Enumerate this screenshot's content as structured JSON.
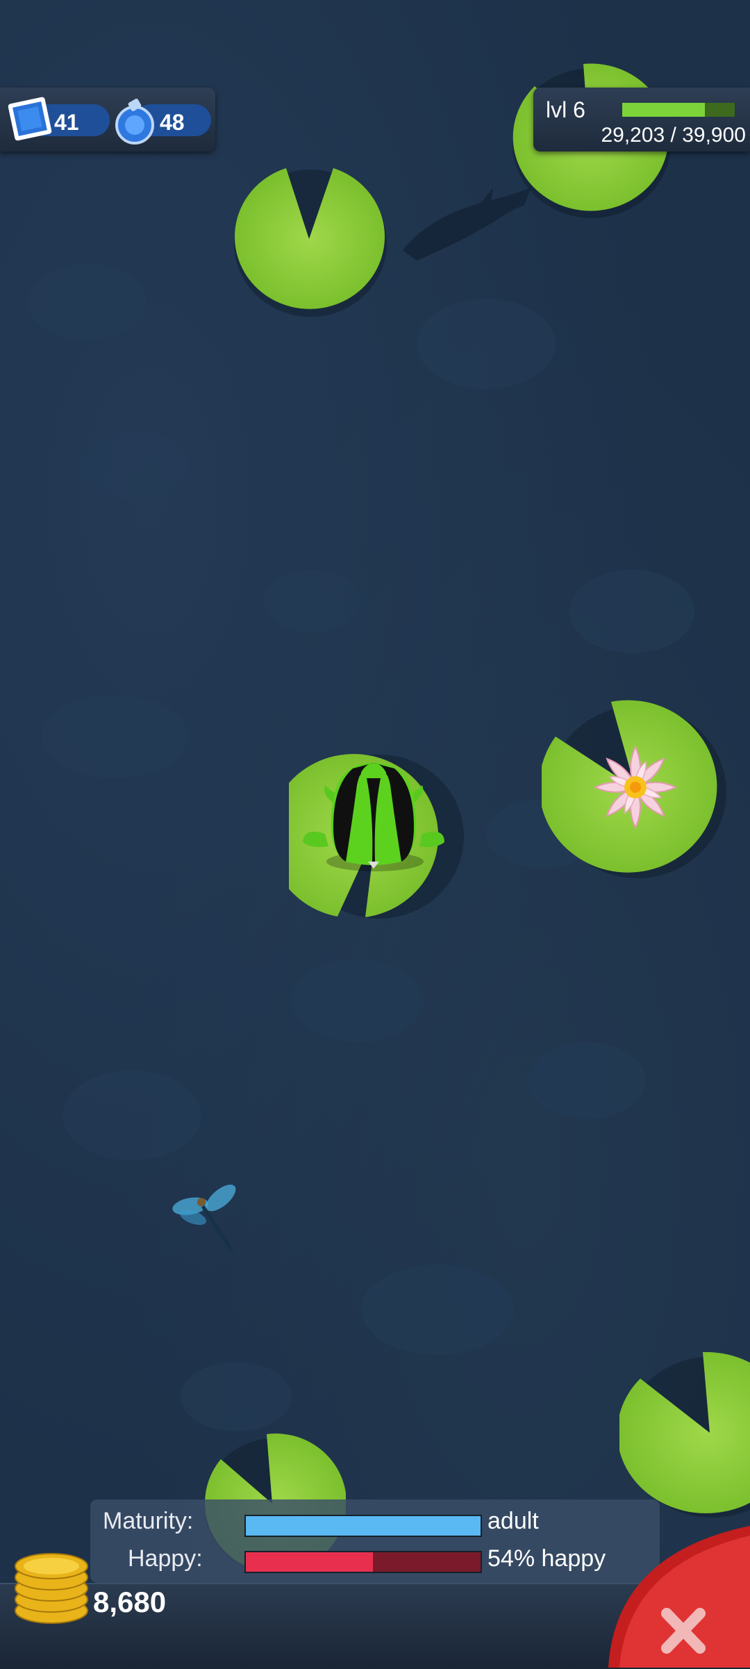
{
  "currency": {
    "stamps_icon": "stamp-icon",
    "stamps": "41",
    "potions_icon": "potion-icon",
    "potions": "48"
  },
  "level": {
    "label": "lvl 6",
    "xp_current": 29203,
    "xp_max": 39900,
    "xp_text": "29,203 / 39,900",
    "xp_color": "#7cd43a"
  },
  "status": {
    "maturity_label": "Maturity:",
    "maturity_value": "adult",
    "maturity_fraction": 1.0,
    "maturity_color": "#5ab8f2",
    "happy_label": "Happy:",
    "happy_value": "54% happy",
    "happy_fraction": 0.54,
    "happy_color": "#e8304e"
  },
  "coins": {
    "icon": "gold-coins-icon",
    "amount": "8,680"
  },
  "close_button": {
    "icon": "close-x-icon",
    "color": "#d42a2a"
  },
  "scene": {
    "pet": "frog-icon",
    "flower": "lotus-flower-icon",
    "insect": "dragonfly-icon",
    "fish": "fish-shadow-icon"
  }
}
